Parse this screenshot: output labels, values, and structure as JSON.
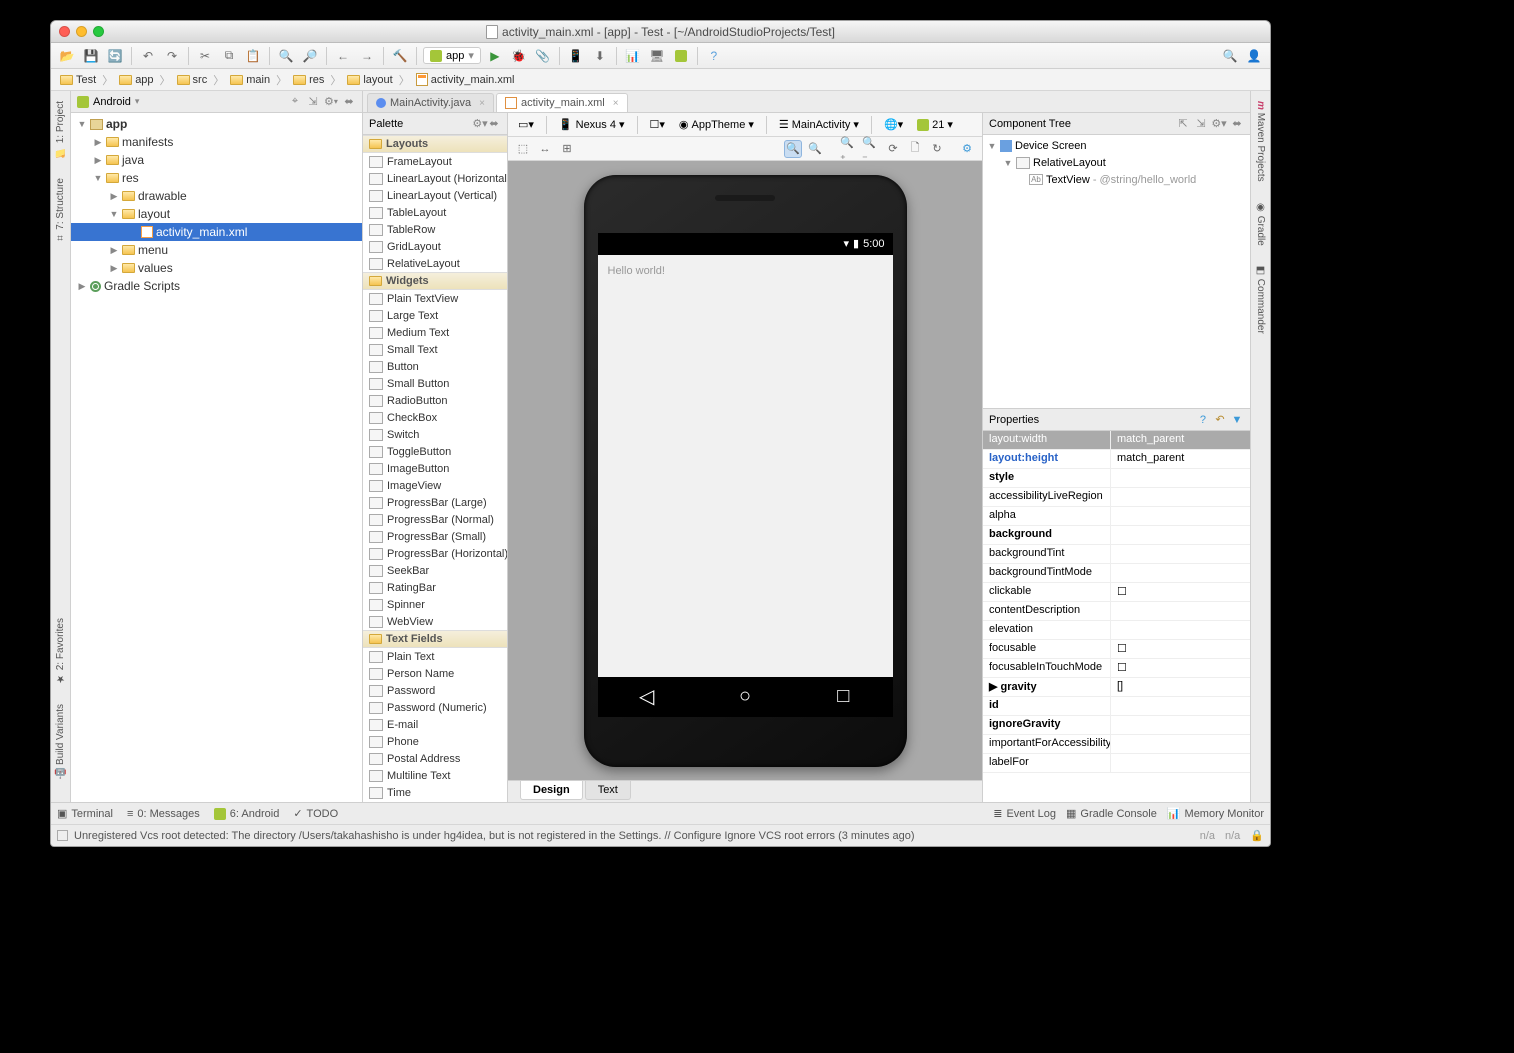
{
  "title": "activity_main.xml - [app] - Test - [~/AndroidStudioProjects/Test]",
  "breadcrumb": [
    "Test",
    "app",
    "src",
    "main",
    "res",
    "layout",
    "activity_main.xml"
  ],
  "projectPanel": {
    "mode": "Android",
    "tree": {
      "app": "app",
      "manifests": "manifests",
      "java": "java",
      "res": "res",
      "drawable": "drawable",
      "layout": "layout",
      "activity_main": "activity_main.xml",
      "menu": "menu",
      "values": "values",
      "gradle": "Gradle Scripts"
    }
  },
  "editorTabs": {
    "t1": "MainActivity.java",
    "t2": "activity_main.xml"
  },
  "palette": {
    "title": "Palette",
    "groups": {
      "layouts": "Layouts",
      "widgets": "Widgets",
      "textfields": "Text Fields"
    },
    "layouts": [
      "FrameLayout",
      "LinearLayout (Horizontal)",
      "LinearLayout (Vertical)",
      "TableLayout",
      "TableRow",
      "GridLayout",
      "RelativeLayout"
    ],
    "widgets": [
      "Plain TextView",
      "Large Text",
      "Medium Text",
      "Small Text",
      "Button",
      "Small Button",
      "RadioButton",
      "CheckBox",
      "Switch",
      "ToggleButton",
      "ImageButton",
      "ImageView",
      "ProgressBar (Large)",
      "ProgressBar (Normal)",
      "ProgressBar (Small)",
      "ProgressBar (Horizontal)",
      "SeekBar",
      "RatingBar",
      "Spinner",
      "WebView"
    ],
    "textfields": [
      "Plain Text",
      "Person Name",
      "Password",
      "Password (Numeric)",
      "E-mail",
      "Phone",
      "Postal Address",
      "Multiline Text",
      "Time"
    ]
  },
  "canvasToolbar": {
    "device": "Nexus 4",
    "theme": "AppTheme",
    "activity": "MainActivity",
    "api": "21"
  },
  "phone": {
    "time": "5:00",
    "hello": "Hello world!"
  },
  "designTabs": {
    "design": "Design",
    "text": "Text"
  },
  "componentTree": {
    "title": "Component Tree",
    "deviceScreen": "Device Screen",
    "relativeLayout": "RelativeLayout",
    "textview": "TextView",
    "textviewVal": "@string/hello_world"
  },
  "properties": {
    "title": "Properties",
    "rows": [
      {
        "k": "layout:width",
        "v": "match_parent",
        "hdr": true
      },
      {
        "k": "layout:height",
        "v": "match_parent",
        "blue": true,
        "bold": true
      },
      {
        "k": "style",
        "v": "",
        "bold": true
      },
      {
        "k": "accessibilityLiveRegion",
        "v": ""
      },
      {
        "k": "alpha",
        "v": ""
      },
      {
        "k": "background",
        "v": "",
        "bold": true
      },
      {
        "k": "backgroundTint",
        "v": ""
      },
      {
        "k": "backgroundTintMode",
        "v": ""
      },
      {
        "k": "clickable",
        "v": "☐"
      },
      {
        "k": "contentDescription",
        "v": ""
      },
      {
        "k": "elevation",
        "v": ""
      },
      {
        "k": "focusable",
        "v": "☐"
      },
      {
        "k": "focusableInTouchMode",
        "v": "☐"
      },
      {
        "k": "gravity",
        "v": "[]",
        "bold": true,
        "arrow": true
      },
      {
        "k": "id",
        "v": "",
        "bold": true
      },
      {
        "k": "ignoreGravity",
        "v": "",
        "bold": true
      },
      {
        "k": "importantForAccessibility",
        "v": ""
      },
      {
        "k": "labelFor",
        "v": ""
      }
    ]
  },
  "sideTabs": {
    "left": {
      "project": "1: Project",
      "structure": "7: Structure",
      "favorites": "2: Favorites",
      "build": "Build Variants"
    },
    "right": {
      "maven": "Maven Projects",
      "gradle": "Gradle",
      "commander": "Commander"
    }
  },
  "bottomBar": {
    "terminal": "Terminal",
    "messages": "0: Messages",
    "android": "6: Android",
    "todo": "TODO",
    "eventLog": "Event Log",
    "gradleConsole": "Gradle Console",
    "memory": "Memory Monitor"
  },
  "statusMsg": "Unregistered Vcs root detected: The directory /Users/takahashisho is under hg4idea, but is not registered in the Settings. // Configure  Ignore VCS root errors (3 minutes ago)",
  "na": "n/a"
}
